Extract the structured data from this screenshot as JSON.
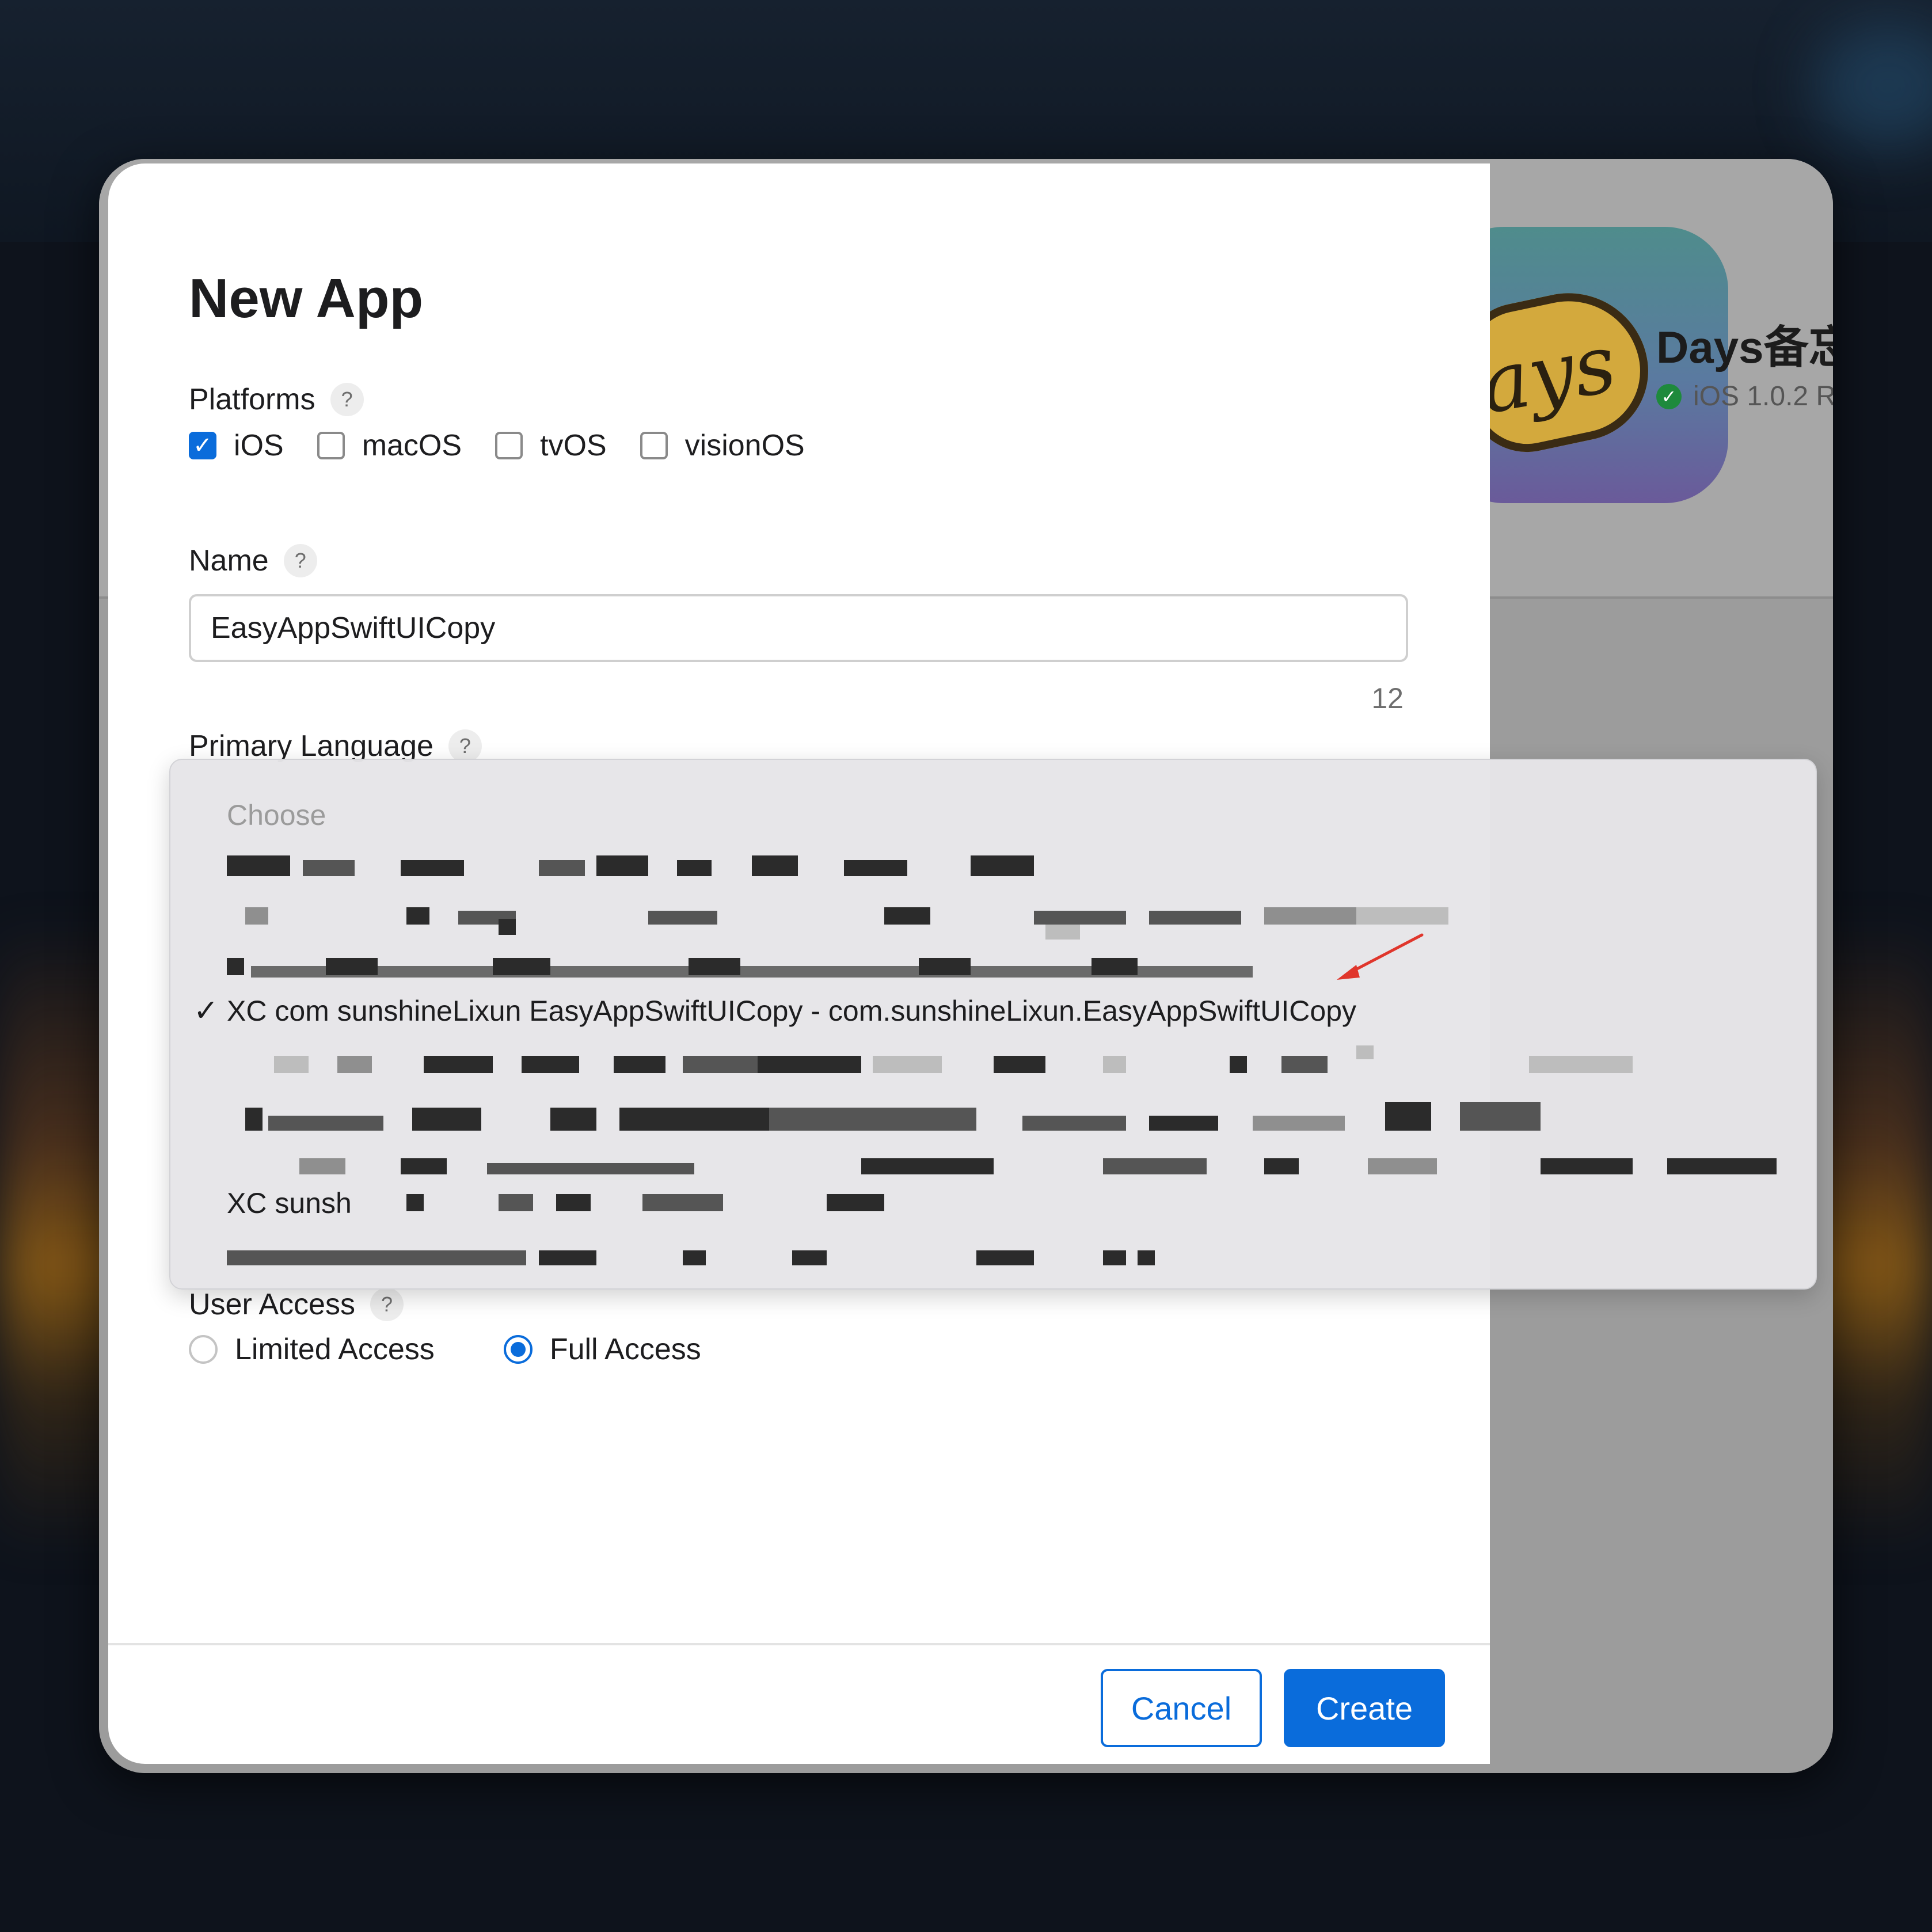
{
  "modal": {
    "title": "New App",
    "platforms": {
      "label": "Platforms",
      "help": "?",
      "options": [
        {
          "label": "iOS",
          "checked": true
        },
        {
          "label": "macOS",
          "checked": false
        },
        {
          "label": "tvOS",
          "checked": false
        },
        {
          "label": "visionOS",
          "checked": false
        }
      ]
    },
    "name": {
      "label": "Name",
      "help": "?",
      "value": "EasyAppSwiftUICopy",
      "char_count": "12"
    },
    "primary_language": {
      "label": "Primary Language",
      "help": "?"
    },
    "bundle_dropdown": {
      "placeholder": "Choose",
      "checkmark": "✓",
      "items": [
        {
          "text": "XC com sunshineLixun EasyAppSwiftUICopy - com.sunshineLixun.EasyAppSwiftUICopy",
          "selected": true
        },
        {
          "text": "XC sunsh",
          "selected": false
        }
      ]
    },
    "user_access": {
      "label": "User Access",
      "help": "?",
      "options": [
        {
          "label": "Limited Access",
          "selected": false
        },
        {
          "label": "Full Access",
          "selected": true
        }
      ]
    },
    "buttons": {
      "cancel": "Cancel",
      "create": "Create"
    }
  },
  "background_app": {
    "title": "Days备忘",
    "status": "iOS 1.0.2 R",
    "status_icon": "checkmark-circle-icon",
    "icon_text": "ays"
  },
  "colors": {
    "accent": "#0a6cdb",
    "annotation_arrow": "#e0362c"
  }
}
